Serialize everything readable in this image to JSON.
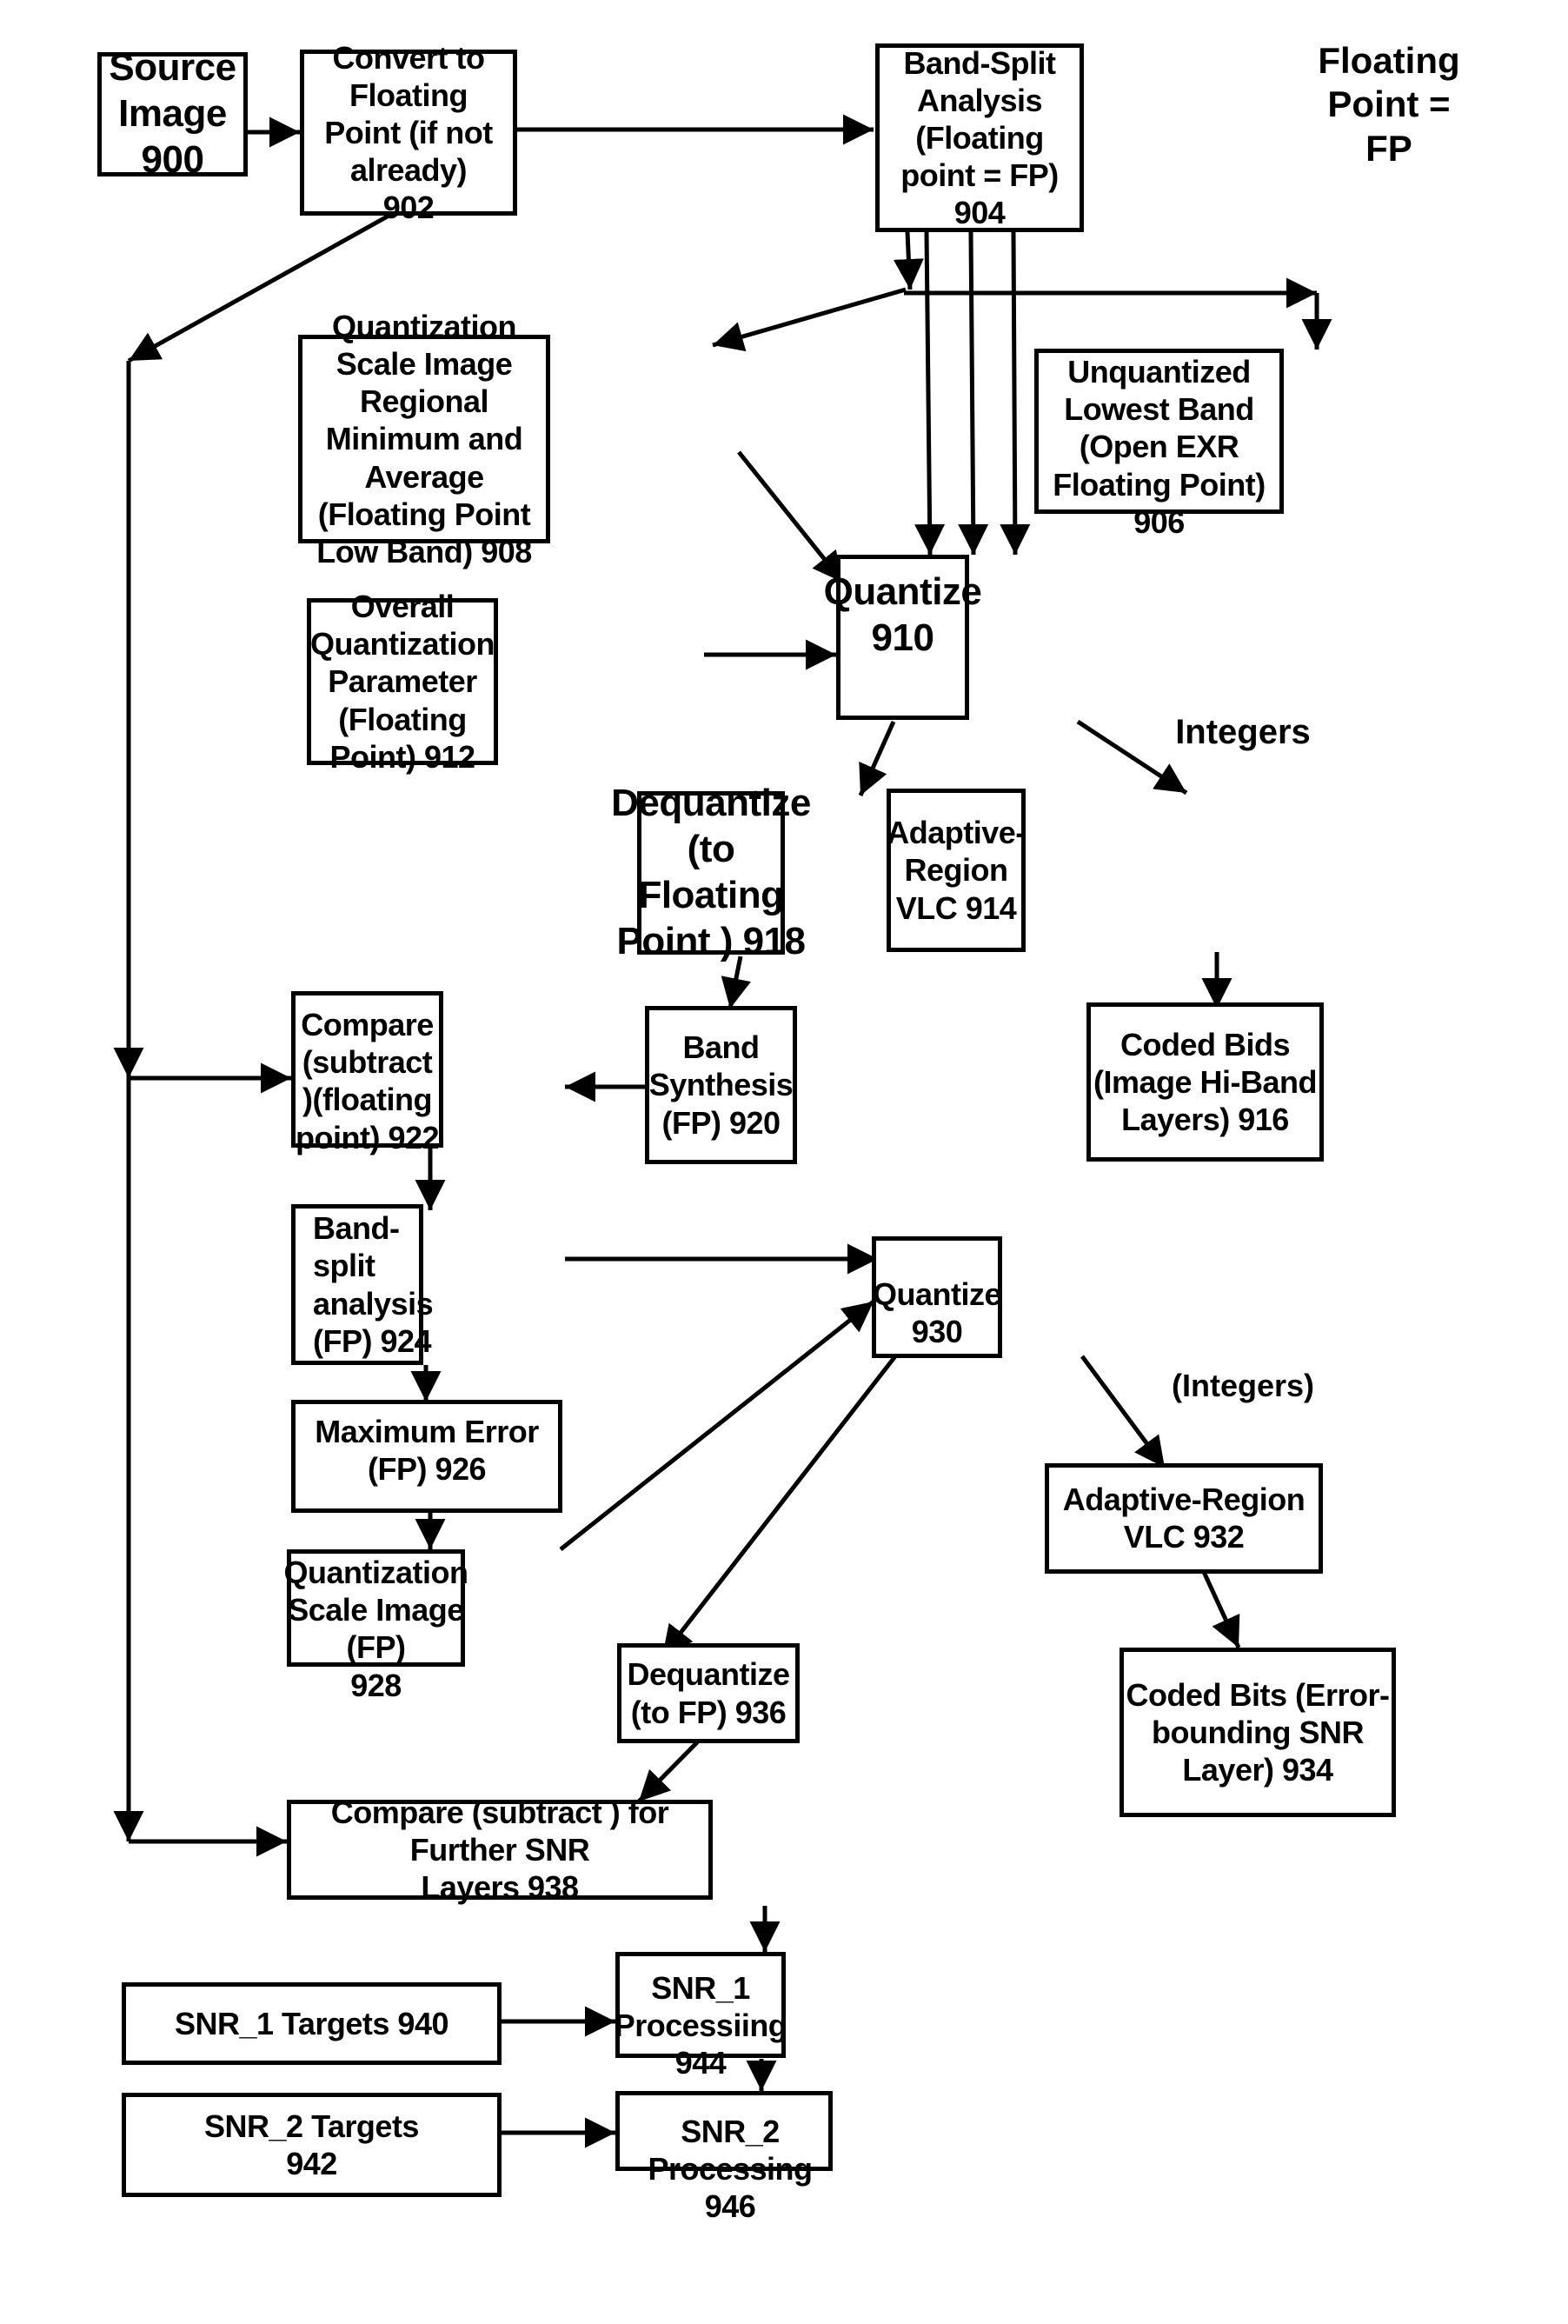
{
  "diagram": {
    "legend": "Floating\nPoint =\nFP",
    "edge_labels": {
      "integers_top": "Integers",
      "integers_bottom": "(Integers)"
    },
    "nodes": {
      "n900": "Source\nImage 900",
      "n902": "Convert to Floating\nPoint (if not already)\n902",
      "n904": "Band-Split Analysis\n(Floating point = FP)\n904",
      "n906": "Unquantized\nLowest Band\n(Open EXR\nFloating Point) 906",
      "n908": "Quantization Scale Image\nRegional Minimum and\nAverage (Floating Point\nLow Band) 908",
      "n910": "Quantize\n910",
      "n912": "Overall Quantization\nParameter (Floating\nPoint) 912",
      "n914": "Adaptive-\nRegion\nVLC 914",
      "n916": "Coded Bids\n(Image Hi-Band\nLayers) 916",
      "n918": "Dequantize\n(to Floating\nPoint ) 918",
      "n920": "Band\nSynthesis\n(FP) 920",
      "n922": "Compare\n(subtract )(floating\npoint) 922",
      "n924": "Band-split\nanalysis\n(FP) 924",
      "n926": "Maximum Error\n(FP) 926",
      "n928": "Quantization\nScale Image (FP)\n928",
      "n930": "Quantize 930",
      "n932": "Adaptive-Region\nVLC 932",
      "n934": "Coded Bits (Error-\nbounding SNR\nLayer) 934",
      "n936": "Dequantize\n(to FP) 936",
      "n938": "Compare (subtract ) for Further SNR\nLayers 938",
      "n940": "SNR_1 Targets 940",
      "n942": "SNR_2 Targets\n942",
      "n944": "SNR_1 Processiing\n944",
      "n946": "SNR_2 Processing 946"
    }
  }
}
